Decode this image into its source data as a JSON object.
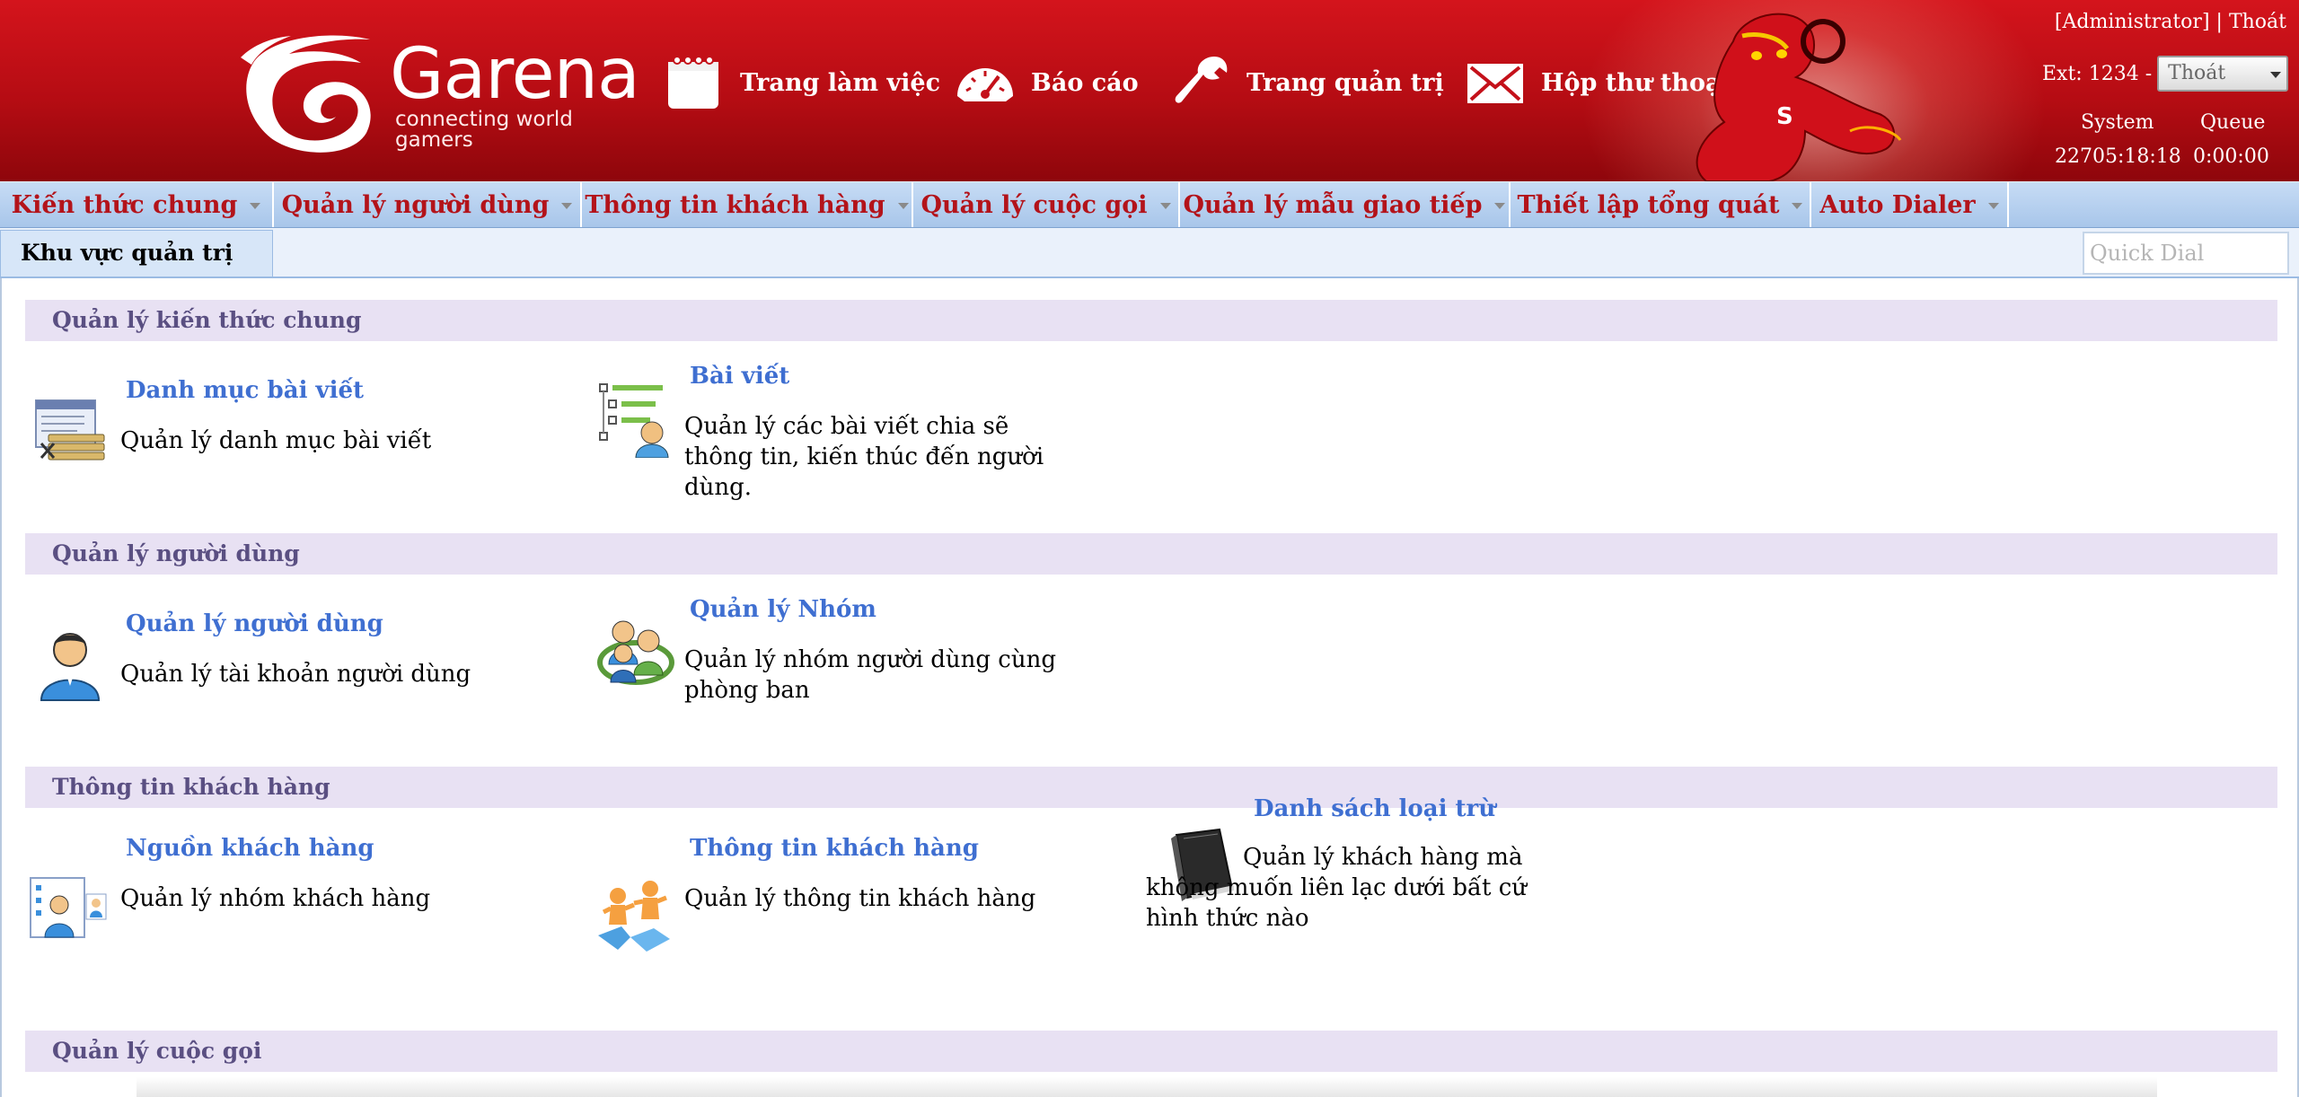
{
  "brand": {
    "name": "Garena",
    "tagline": "connecting world gamers"
  },
  "header_nav": [
    {
      "label": "Trang làm việc",
      "icon": "notepad-icon"
    },
    {
      "label": "Báo cáo",
      "icon": "speedometer-icon"
    },
    {
      "label": "Trang quản trị",
      "icon": "wrench-icon"
    },
    {
      "label": "Hộp thư thoại",
      "icon": "envelope-icon"
    }
  ],
  "user": {
    "name": "[Administrator]",
    "separator": "|",
    "logout": "Thoát",
    "ext_label": "Ext: 1234 -",
    "status_selected": "Thoát",
    "system_label": "System",
    "queue_label": "Queue",
    "system_time": "22705:18:18",
    "queue_time": "0:00:00"
  },
  "menu": [
    "Kiến thức chung",
    "Quản lý người dùng",
    "Thông tin khách hàng",
    "Quản lý cuộc gọi",
    "Quản lý mẫu giao tiếp",
    "Thiết lập tổng quát",
    "Auto Dialer"
  ],
  "breadcrumb": "Khu vực quản trị",
  "quick_dial": {
    "placeholder": "Quick Dial"
  },
  "sections": [
    {
      "title": "Quản lý kiến thức chung",
      "items": [
        {
          "title": "Danh mục bài viết",
          "desc": "Quản lý danh mục bài viết",
          "icon": "article-category-icon"
        },
        {
          "title": "Bài viết",
          "desc": "Quản lý các bài viết chia sẽ thông tin, kiến thúc đến người dùng.",
          "icon": "article-tree-icon"
        }
      ]
    },
    {
      "title": "Quản lý người dùng",
      "items": [
        {
          "title": "Quản lý người dùng",
          "desc": "Quản lý tài khoản người dùng",
          "icon": "user-icon"
        },
        {
          "title": "Quản lý Nhóm",
          "desc": "Quản lý nhóm người dùng cùng phòng ban",
          "icon": "user-group-icon"
        }
      ]
    },
    {
      "title": "Thông tin khách hàng",
      "items": [
        {
          "title": "Nguồn khách hàng",
          "desc": "Quản lý nhóm khách hàng",
          "icon": "customer-source-icon"
        },
        {
          "title": "Thông tin khách hàng",
          "desc": "Quản lý thông tin khách hàng",
          "icon": "customer-puzzle-icon"
        },
        {
          "title": "Danh sách loại trừ",
          "desc": "Quản lý khách hàng mà không muốn liên lạc dưới bất cứ hình thức nào",
          "icon": "black-notebook-icon"
        }
      ]
    },
    {
      "title": "Quản lý cuộc gọi",
      "items": []
    }
  ],
  "colors": {
    "header_red": "#c4111a",
    "menu_text": "#b3131a",
    "link_blue": "#3f6fd1",
    "section_bg": "#e8e1f3",
    "section_text": "#5a4f82"
  }
}
